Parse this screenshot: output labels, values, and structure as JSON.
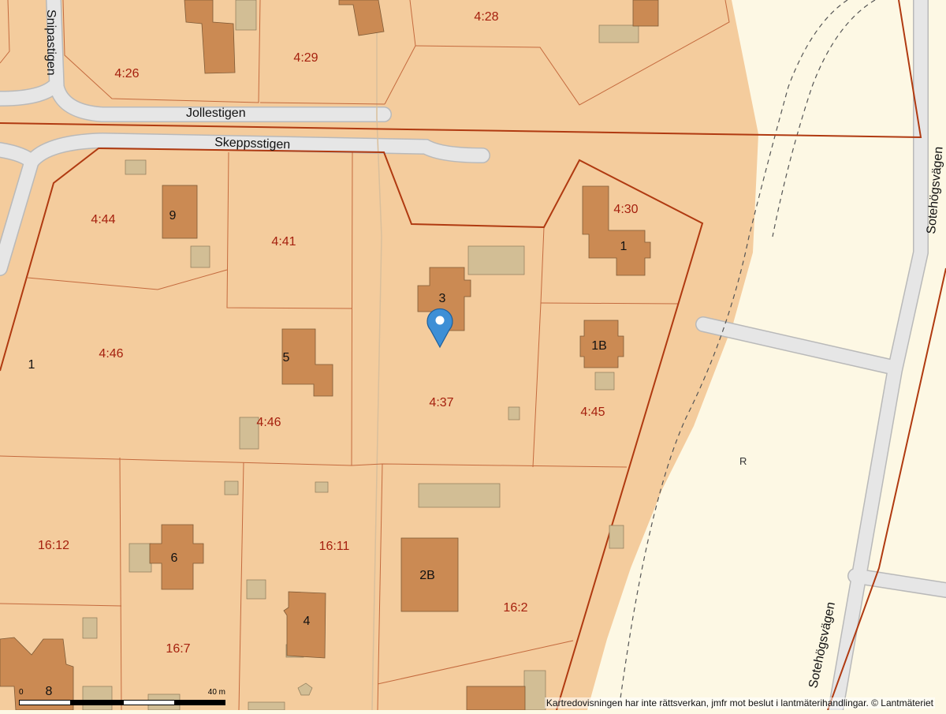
{
  "map": {
    "colors": {
      "land": "#f4cc9d",
      "outside": "#fdf8e4",
      "road": "#e6e6e6",
      "road_edge": "#b9b9b9",
      "house": "#cb8a53",
      "outbuilding": "#d2be95",
      "boundary_major": "#b03a11",
      "boundary_minor": "#c46a3e",
      "parcel_label": "#a5200e",
      "marker": "#3d8fd6"
    },
    "parcel_labels": [
      "4:28",
      "4:26",
      "4:29",
      "4:44",
      "4:41",
      "4:30",
      "4:46",
      "4:37",
      "4:45",
      "4:46",
      "16:12",
      "16:11",
      "16:2",
      "16:7"
    ],
    "address_numbers": [
      "9",
      "1",
      "3",
      "1",
      "5",
      "1B",
      "6",
      "2B",
      "4",
      "8"
    ],
    "roads": [
      "Snipastigen",
      "Jollestigen",
      "Skeppsstigen",
      "Sotehögsvägen",
      "Sotehögsvägen"
    ],
    "location_marker": {
      "name": "map-pin-icon"
    },
    "misc_symbol": "R"
  },
  "scale": {
    "start": "0",
    "end": "40 m"
  },
  "attribution": "Kartredovisningen har inte rättsverkan, jmfr mot beslut i lantmäterihandlingar. © Lantmäteriet"
}
